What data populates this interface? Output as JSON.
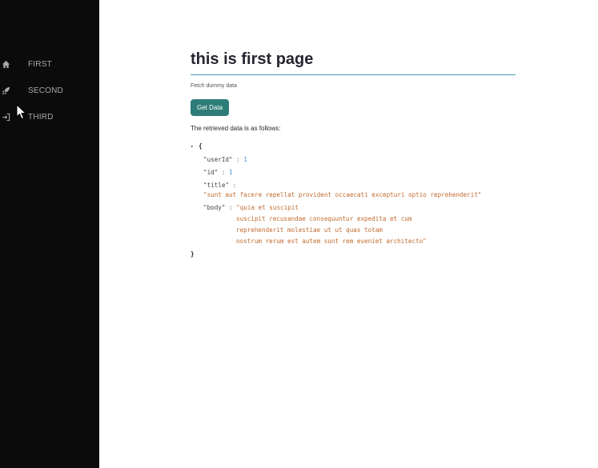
{
  "sidebar": {
    "items": [
      {
        "label": "FIRST",
        "icon": "home-icon"
      },
      {
        "label": "SECOND",
        "icon": "rocket-icon"
      },
      {
        "label": "THIRD",
        "icon": "sign-in-icon"
      }
    ]
  },
  "main": {
    "title": "this is first page",
    "caption": "Fetch dummy data",
    "button_label": "Get Data",
    "result_label": "The retrieved data is as follows:",
    "json": {
      "open_brace": "{",
      "close_brace": "}",
      "toggle": "▾",
      "userId_key": "\"userId\"",
      "userId_value": "1",
      "id_key": "\"id\"",
      "id_value": "1",
      "title_key": "\"title\"",
      "title_value": "\"sunt aut facere repellat provident occaecati excepturi optio reprehenderit\"",
      "body_key": "\"body\"",
      "body_line1": "\"quia et suscipit",
      "body_line2": "suscipit recusandae consequuntur expedita et cum",
      "body_line3": "reprehenderit molestiae ut ut quas totam",
      "body_line4": "nostrum rerum est autem sunt rem eveniet architecto\""
    }
  },
  "colors": {
    "sidebar_bg": "#0b0b0b",
    "accent": "#2e7d78",
    "title_underline": "#4b9db1"
  }
}
